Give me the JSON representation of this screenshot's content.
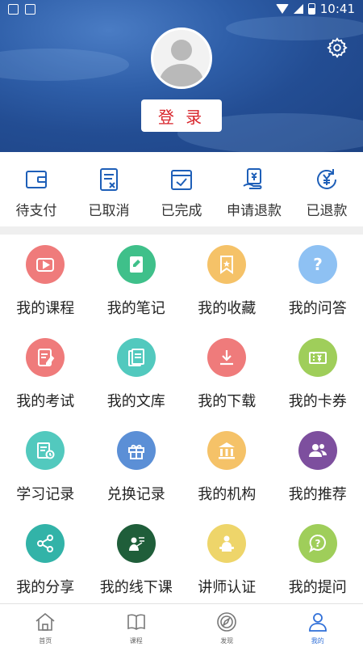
{
  "status_bar": {
    "time": "10:41"
  },
  "header": {
    "login_label": "登 录"
  },
  "orders": [
    {
      "label": "待支付",
      "icon": "wallet-icon"
    },
    {
      "label": "已取消",
      "icon": "cancelled-doc-icon"
    },
    {
      "label": "已完成",
      "icon": "completed-check-icon"
    },
    {
      "label": "申请退款",
      "icon": "refund-request-icon"
    },
    {
      "label": "已退款",
      "icon": "refunded-yen-icon"
    }
  ],
  "grid": [
    {
      "label": "我的课程",
      "icon": "tv-icon",
      "color": "#ef7b7b"
    },
    {
      "label": "我的笔记",
      "icon": "note-icon",
      "color": "#3fc08a"
    },
    {
      "label": "我的收藏",
      "icon": "bookmark-icon",
      "color": "#f5c268"
    },
    {
      "label": "我的问答",
      "icon": "question-icon",
      "color": "#8ec1f3"
    },
    {
      "label": "我的考试",
      "icon": "exam-icon",
      "color": "#ef7b7b"
    },
    {
      "label": "我的文库",
      "icon": "library-icon",
      "color": "#52c9be"
    },
    {
      "label": "我的下载",
      "icon": "download-icon",
      "color": "#ef7b7b"
    },
    {
      "label": "我的卡券",
      "icon": "coupon-icon",
      "color": "#9fce5a"
    },
    {
      "label": "学习记录",
      "icon": "study-record-icon",
      "color": "#52c9be"
    },
    {
      "label": "兑换记录",
      "icon": "gift-icon",
      "color": "#5b8fd6"
    },
    {
      "label": "我的机构",
      "icon": "institution-icon",
      "color": "#f5c268"
    },
    {
      "label": "我的推荐",
      "icon": "recommend-users-icon",
      "color": "#7d4f9e"
    },
    {
      "label": "我的分享",
      "icon": "share-icon",
      "color": "#32b3a8"
    },
    {
      "label": "我的线下课",
      "icon": "offline-class-icon",
      "color": "#1f5e3a"
    },
    {
      "label": "讲师认证",
      "icon": "teacher-icon",
      "color": "#eed56a"
    },
    {
      "label": "我的提问",
      "icon": "ask-icon",
      "color": "#9fce5a"
    }
  ],
  "tabbar": [
    {
      "label": "首页",
      "icon": "home-icon"
    },
    {
      "label": "课程",
      "icon": "book-icon"
    },
    {
      "label": "发现",
      "icon": "discover-icon"
    },
    {
      "label": "我的",
      "icon": "profile-icon",
      "active": true
    }
  ],
  "colors": {
    "accent": "#2f6fd8",
    "login_text": "#d8232a",
    "order_icon": "#1e5fb8"
  }
}
